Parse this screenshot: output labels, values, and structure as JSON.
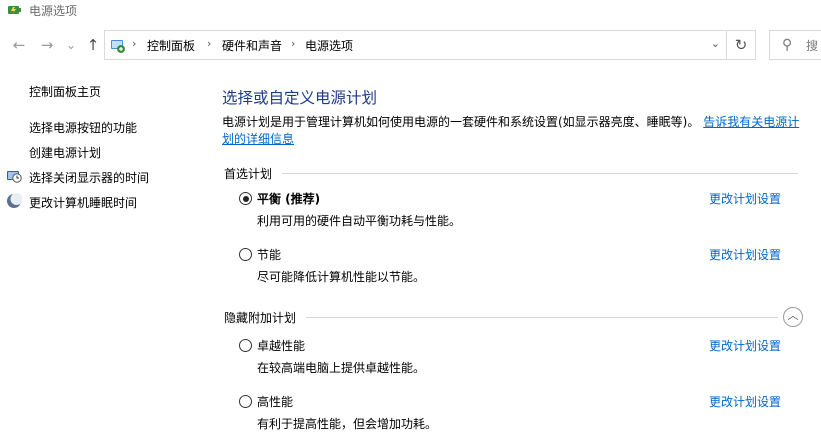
{
  "window": {
    "title": "电源选项"
  },
  "nav": {
    "back_glyph": "←",
    "forward_glyph": "→",
    "recent_glyph": "⌄",
    "up_glyph": "↑",
    "breadcrumb": [
      "控制面板",
      "硬件和声音",
      "电源选项"
    ],
    "separator": "›",
    "dropdown_glyph": "⌄",
    "refresh_glyph": "↻",
    "search_icon_glyph": "⚲",
    "search_placeholder": "搜"
  },
  "sidebar": {
    "home_link": "控制面板主页",
    "links": [
      {
        "label": "选择电源按钮的功能",
        "icon": ""
      },
      {
        "label": "创建电源计划",
        "icon": ""
      },
      {
        "label": "选择关闭显示器的时间",
        "icon": "monitor-clock-icon"
      },
      {
        "label": "更改计算机睡眠时间",
        "icon": "moon-icon"
      }
    ]
  },
  "main": {
    "title": "选择或自定义电源计划",
    "description": "电源计划是用于管理计算机如何使用电源的一套硬件和系统设置(如显示器亮度、睡眠等)。",
    "description_link": "告诉我有关电源计划的详细信息",
    "preferred_group": {
      "label": "首选计划",
      "plans": [
        {
          "name": "平衡 (推荐)",
          "desc": "利用可用的硬件自动平衡功耗与性能。",
          "link": "更改计划设置",
          "selected": true
        },
        {
          "name": "节能",
          "desc": "尽可能降低计算机性能以节能。",
          "link": "更改计划设置",
          "selected": false
        }
      ]
    },
    "hidden_group": {
      "label": "隐藏附加计划",
      "collapse_glyph": "︿",
      "plans": [
        {
          "name": "卓越性能",
          "desc": "在较高端电脑上提供卓越性能。",
          "link": "更改计划设置",
          "selected": false
        },
        {
          "name": "高性能",
          "desc": "有利于提高性能，但会增加功耗。",
          "link": "更改计划设置",
          "selected": false
        }
      ]
    }
  },
  "colors": {
    "title_blue": "#1e3a8a",
    "link_blue": "#0066cc"
  }
}
